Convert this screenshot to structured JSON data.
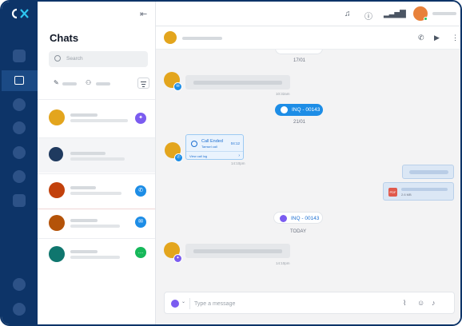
{
  "brand": {
    "logo_text": "CX"
  },
  "chat_list": {
    "title": "Chats",
    "search_placeholder": "Search",
    "items": [
      {
        "channel": "messenger",
        "channel_color": "#7b5cf0",
        "avatar_color": "#e3a51d"
      },
      {
        "channel": "bot",
        "channel_color": "#1f3a5f",
        "avatar_color": "#1f3a5f"
      },
      {
        "channel": "phone",
        "channel_color": "#1d8de6",
        "avatar_color": "#c2410c"
      },
      {
        "channel": "email",
        "channel_color": "#1d8de6",
        "avatar_color": "#b45309"
      },
      {
        "channel": "line",
        "channel_color": "#16b85a",
        "avatar_color": "#0f766e"
      }
    ]
  },
  "conversation": {
    "dates": [
      "17/01",
      "21/01",
      "TODAY"
    ],
    "timestamps": [
      "10:32am",
      "14:10pm",
      "14:10pm",
      "14:10pm"
    ],
    "pills": [
      {
        "label": "INQ - 00143",
        "style": "blue",
        "icon": "phone"
      },
      {
        "label": "INQ - 00143",
        "style": "white",
        "icon": "messenger"
      }
    ],
    "call_card": {
      "title": "Call Ended",
      "subtitle": "Tamsel call",
      "duration": "04:12",
      "link": "View call log",
      "chevron": "›"
    },
    "pdf": {
      "label": "PDF",
      "size": "2.6 MB"
    }
  },
  "composer": {
    "placeholder": "Type a message",
    "channel_caret": "⌄"
  },
  "colors": {
    "rail": "#0d3468",
    "accent": "#1d8de6",
    "background": "#f3f3f4"
  }
}
